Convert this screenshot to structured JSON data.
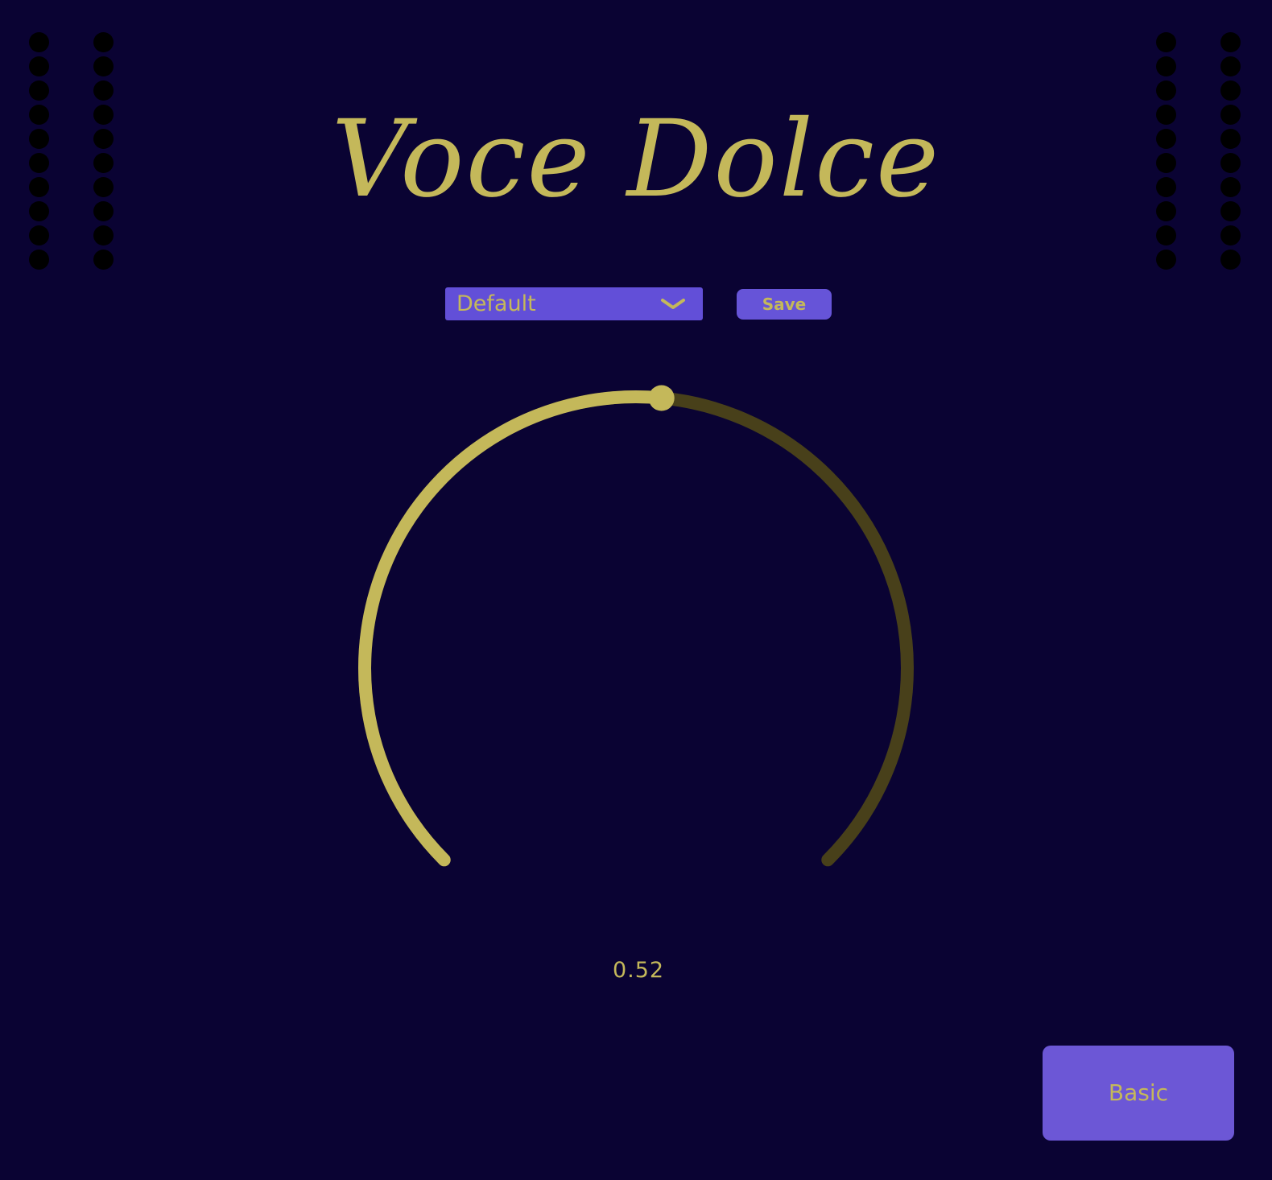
{
  "title": "Voce Dolce",
  "preset": {
    "selected": "Default",
    "dropdown_icon": "chevron-down-icon"
  },
  "save_label": "Save",
  "knob": {
    "value": 0.52,
    "value_label": "0.52",
    "active_color": "#c4b85a",
    "inactive_color": "#48401a"
  },
  "mode_button_label": "Basic",
  "colors": {
    "background": "#0a0333",
    "accent": "#624fd8",
    "text": "#c4b85a",
    "speaker_dots": "#000000"
  },
  "decorations": {
    "speaker_grille_columns": 4,
    "dots_per_column": 10
  }
}
